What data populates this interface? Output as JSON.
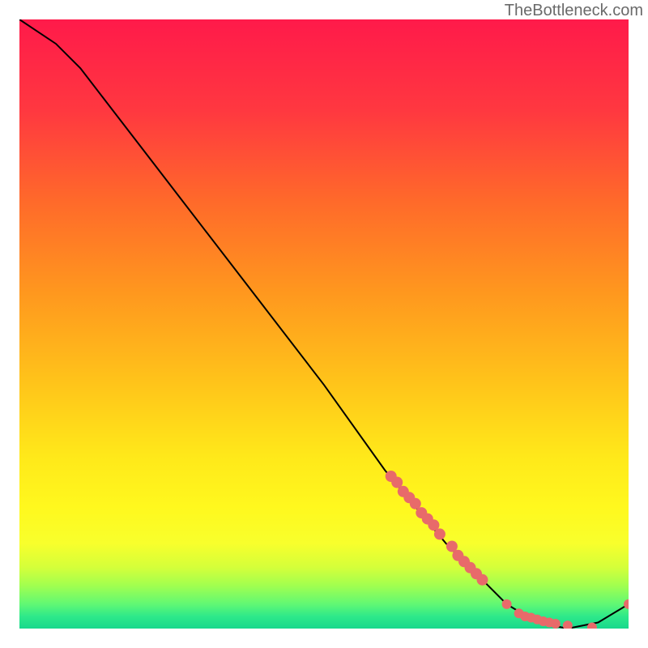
{
  "watermark": "TheBottleneck.com",
  "chart_data": {
    "type": "line",
    "title": "",
    "xlabel": "",
    "ylabel": "",
    "xlim": [
      0,
      100
    ],
    "ylim": [
      0,
      100
    ],
    "grid": false,
    "series": [
      {
        "name": "curve",
        "x": [
          0,
          6,
          10,
          20,
          30,
          40,
          50,
          60,
          70,
          75,
          80,
          85,
          90,
          95,
          100
        ],
        "y": [
          100,
          96,
          92,
          79,
          66,
          53,
          40,
          26,
          14,
          9,
          4,
          1,
          0,
          1,
          4
        ]
      },
      {
        "name": "upper-dots",
        "x": [
          61,
          62,
          63,
          64,
          65,
          66,
          67,
          68,
          69,
          71,
          72,
          73,
          74,
          75,
          76
        ],
        "y": [
          25,
          24,
          22.5,
          21.5,
          20.5,
          19,
          18,
          17,
          15.5,
          13.5,
          12,
          11,
          10,
          9,
          8
        ]
      },
      {
        "name": "lower-dots",
        "x": [
          80,
          82,
          83,
          84,
          85,
          86,
          87,
          88,
          90,
          94,
          100
        ],
        "y": [
          4,
          2.5,
          2,
          1.8,
          1.5,
          1.2,
          1,
          0.8,
          0.5,
          0.2,
          4
        ]
      }
    ],
    "gradient_stops": [
      {
        "offset": 0.0,
        "color": "#ff1a4a"
      },
      {
        "offset": 0.15,
        "color": "#ff3840"
      },
      {
        "offset": 0.3,
        "color": "#ff6a2a"
      },
      {
        "offset": 0.45,
        "color": "#ff981e"
      },
      {
        "offset": 0.6,
        "color": "#ffc51a"
      },
      {
        "offset": 0.72,
        "color": "#ffe91a"
      },
      {
        "offset": 0.8,
        "color": "#fff81e"
      },
      {
        "offset": 0.86,
        "color": "#f8ff2c"
      },
      {
        "offset": 0.9,
        "color": "#d4ff3a"
      },
      {
        "offset": 0.93,
        "color": "#a0ff50"
      },
      {
        "offset": 0.96,
        "color": "#60f874"
      },
      {
        "offset": 0.98,
        "color": "#2ee98a"
      },
      {
        "offset": 1.0,
        "color": "#18d88c"
      }
    ],
    "dot_color": "#e86a6a",
    "curve_color": "#000000"
  }
}
